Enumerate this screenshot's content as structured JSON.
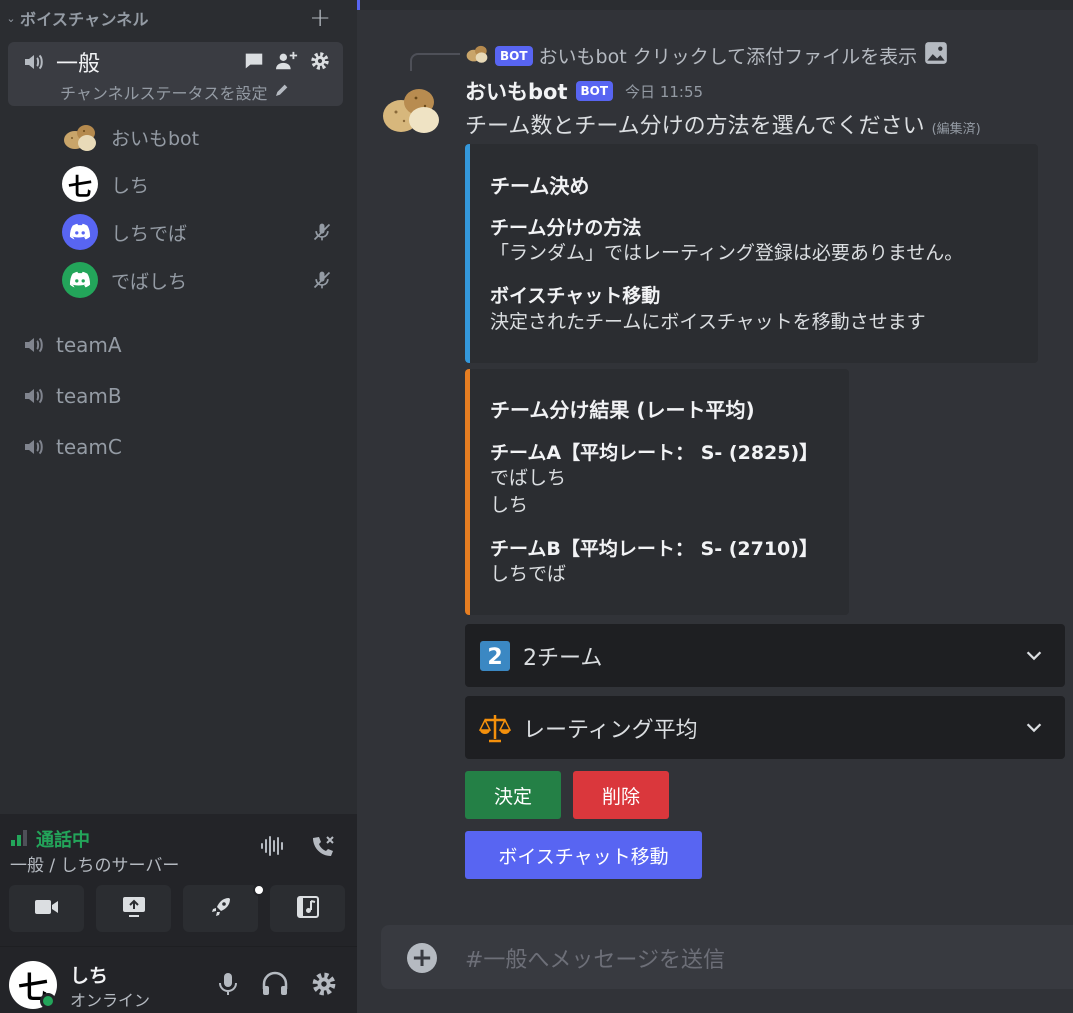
{
  "sidebar": {
    "category": "ボイスチャンネル",
    "general": {
      "name": "一般",
      "status_placeholder": "チャンネルステータスを設定"
    },
    "voice_users": [
      {
        "name": "おいもbot",
        "avatar": "potato-avatar"
      },
      {
        "name": "しち",
        "avatar": "shichi-avatar"
      },
      {
        "name": "しちでば",
        "avatar": "discord-blue-avatar",
        "muted": true
      },
      {
        "name": "でばしち",
        "avatar": "discord-green-avatar",
        "muted": true
      }
    ],
    "channels": [
      "teamA",
      "teamB",
      "teamC"
    ]
  },
  "voice_panel": {
    "status": "通話中",
    "location": "一般 / しちのサーバー"
  },
  "user_panel": {
    "name": "しち",
    "status": "オンライン",
    "avatar_glyph": "七"
  },
  "message": {
    "reply_author": "おいもbot",
    "reply_text": "クリックして添付ファイルを表示",
    "bot_tag": "BOT",
    "author": "おいもbot",
    "timestamp": "今日 11:55",
    "text": "チーム数とチーム分けの方法を選んでください",
    "edited": "(編集済)"
  },
  "embed1": {
    "title": "チーム決め",
    "accent": "#3498db",
    "fields": [
      {
        "name": "チーム分けの方法",
        "value": "「ランダム」ではレーティング登録は必要ありません。"
      },
      {
        "name": "ボイスチャット移動",
        "value": "決定されたチームにボイスチャットを移動させます"
      }
    ]
  },
  "embed2": {
    "title": "チーム分け結果 (レート平均)",
    "accent": "#e67e22",
    "fields": [
      {
        "name": "チームA【平均レート： S- (2825)】",
        "value": "でばしち\nしち"
      },
      {
        "name": "チームB【平均レート： S- (2710)】",
        "value": "しちでば"
      }
    ]
  },
  "selects": [
    {
      "label": "2チーム",
      "icon": "keycap-2-icon"
    },
    {
      "label": "レーティング平均",
      "icon": "balance-scale-icon"
    }
  ],
  "buttons": {
    "decide": "決定",
    "delete": "削除",
    "move": "ボイスチャット移動"
  },
  "composer": {
    "placeholder": "#一般へメッセージを送信"
  },
  "colors": {
    "accent": "#5865f2",
    "green": "#248046",
    "red": "#da373c",
    "online": "#23a55a"
  }
}
